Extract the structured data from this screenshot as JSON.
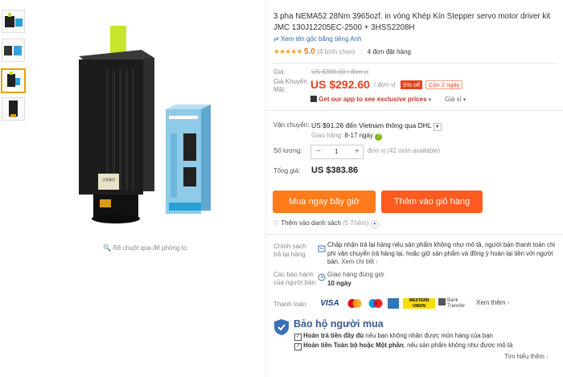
{
  "product": {
    "title": "3 pha NEMA52 28Nm 3965ozf. in vòng Khép Kín Stepper servo motor driver kit JMC 130J12205EC-2500 + 3HSS2208H",
    "translate_link": "Xem tên gốc bằng tiếng Anh",
    "stars": "★★★★★",
    "rating_score": "5.0",
    "rating_count": "(4 bình chọn)",
    "orders": "4 đơn đặt hàng"
  },
  "gallery": {
    "zoom_hint": "Rê chuột qua để phóng to",
    "motor_label": "注意事项"
  },
  "price": {
    "label_original": "Giá:",
    "original": "US $308.00 / đơn vị",
    "label_promo": "Giá Khuyến Mãi:",
    "promo": "US $292.60",
    "unit": "/ đơn vị",
    "discount": "5% off",
    "days_left": "Còn 2 ngày",
    "app_offer": "Get our app to see exclusive prices",
    "tiered": "Giá sỉ"
  },
  "shipping": {
    "label": "Vận chuyển:",
    "value": "US $91.26 đến Vietnam thông qua DHL",
    "delivery_label": "Giao hàng:",
    "delivery_time": "8-17 ngày"
  },
  "quantity": {
    "label": "Số lượng:",
    "minus": "−",
    "value": "1",
    "plus": "+",
    "available": "đơn vị (42 món available)"
  },
  "total": {
    "label": "Tổng giá:",
    "value": "US $383.86"
  },
  "actions": {
    "buy_now": "Mua ngay bây giờ",
    "add_to_cart": "Thêm vào giỏ hàng",
    "wishlist": "Thêm vào danh sách",
    "wishlist_count": "(5 Thêm)"
  },
  "policies": {
    "return_label": "Chính sách trả lại hàng",
    "return_text": "Chấp nhận trả lại hàng nếu sản phẩm không như mô tả, người bán thanh toán chi phí vận chuyển trả hàng lại, hoặc giữ sản phẩm và đồng ý hoàn lại tiền với người bán.",
    "return_more": "Xem chi tiết",
    "seller_label": "Các bảo hành của người bán:",
    "seller_text": "Giao hàng đúng giờ",
    "seller_days": "10 ngày",
    "payment_label": "Thanh toán:",
    "payment_more": "Xem thêm"
  },
  "payments": {
    "visa": "VISA",
    "western_union": "WESTERN UNION",
    "bank_transfer": "Bank Transfer"
  },
  "buyer_protection": {
    "title": "Bảo hộ người mua",
    "item1_bold": "Hoàn trả tiền đầy đủ",
    "item1_rest": " nếu bạn không nhận được món hàng của bạn",
    "item2_bold": "Hoàn tiền Toàn bộ hoặc Một phần",
    "item2_rest": ", nếu sản phẩm không như được mô tả",
    "learn_more": "Tìm hiểu thêm"
  },
  "colors": {
    "accent_price": "#e8401c",
    "buy_button": "#ff7a1a",
    "cart_button": "#ff5a1f",
    "link": "#2b6cb0",
    "star": "#f5a623"
  }
}
